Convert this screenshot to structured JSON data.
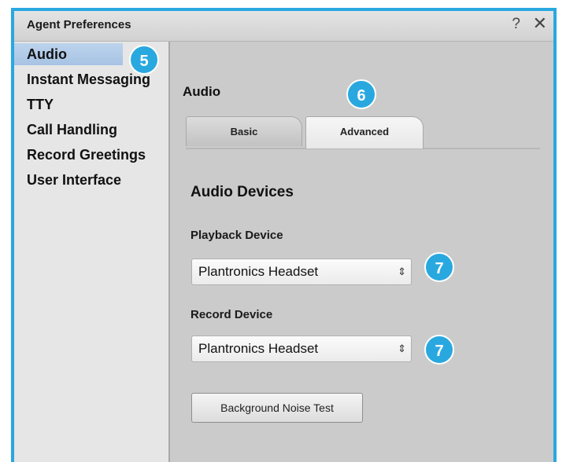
{
  "window": {
    "title": "Agent Preferences",
    "help_glyph": "?",
    "close_glyph": "✕"
  },
  "sidebar": {
    "items": [
      {
        "label": "Audio",
        "selected": true
      },
      {
        "label": "Instant Messaging",
        "selected": false
      },
      {
        "label": "TTY",
        "selected": false
      },
      {
        "label": "Call Handling",
        "selected": false
      },
      {
        "label": "Record Greetings",
        "selected": false
      },
      {
        "label": "User Interface",
        "selected": false
      }
    ]
  },
  "badges": {
    "sidebar": "5",
    "tabs": "6",
    "playback": "7",
    "record": "7"
  },
  "content": {
    "section_title": "Audio",
    "tabs": [
      {
        "label": "Basic",
        "active": false
      },
      {
        "label": "Advanced",
        "active": true
      }
    ],
    "heading": "Audio Devices",
    "playback": {
      "label": "Playback Device",
      "value": "Plantronics Headset"
    },
    "record": {
      "label": "Record Device",
      "value": "Plantronics Headset"
    },
    "noise_button_label": "Background Noise Test"
  },
  "colors": {
    "accent": "#29a8e0",
    "selected_nav": "#a7c3e4",
    "panel_bg": "#cbcbcb"
  }
}
